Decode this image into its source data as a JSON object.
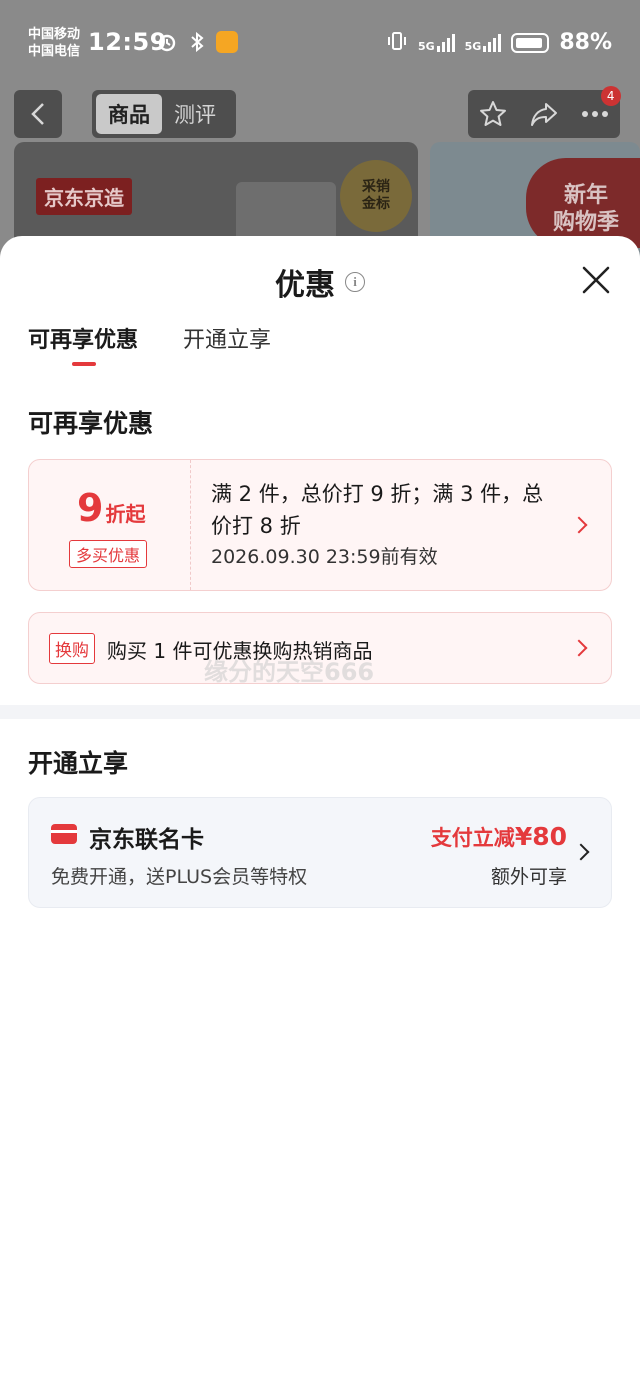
{
  "status_bar": {
    "carrier1": "中国移动",
    "carrier2": "中国电信",
    "time": "12:59",
    "net1": "5G",
    "net2": "5G",
    "battery": "88%"
  },
  "nav": {
    "tab_goods": "商品",
    "tab_reviews": "测评",
    "cart_badge": "4"
  },
  "background": {
    "brand_tag": "京东京造",
    "gold_seal": "采销\n金标",
    "new_year_badge": "新年\n购物季"
  },
  "sheet": {
    "title": "优惠",
    "info_icon_glyph": "i",
    "tabs": [
      "可再享优惠",
      "开通立享"
    ],
    "section1_title": "可再享优惠",
    "promo": {
      "discount_number": "9",
      "discount_unit": "折起",
      "tag": "多买优惠",
      "description": "满 2 件，总价打 9 折；满 3 件，总价打 8 折",
      "validity": "2026.09.30 23:59前有效"
    },
    "swap": {
      "tag": "换购",
      "text": "购买 1 件可优惠换购热销商品"
    },
    "watermark": "缘分的天空666",
    "section2_title": "开通立享",
    "card": {
      "name": "京东联名卡",
      "subtitle": "免费开通，送PLUS会员等特权",
      "offer_prefix": "支付立减",
      "offer_amount": "¥80",
      "extra": "额外可享"
    }
  },
  "colors": {
    "accent_red": "#e4393c",
    "promo_bg": "#fff5f5",
    "card_bg": "#f4f6fa"
  }
}
